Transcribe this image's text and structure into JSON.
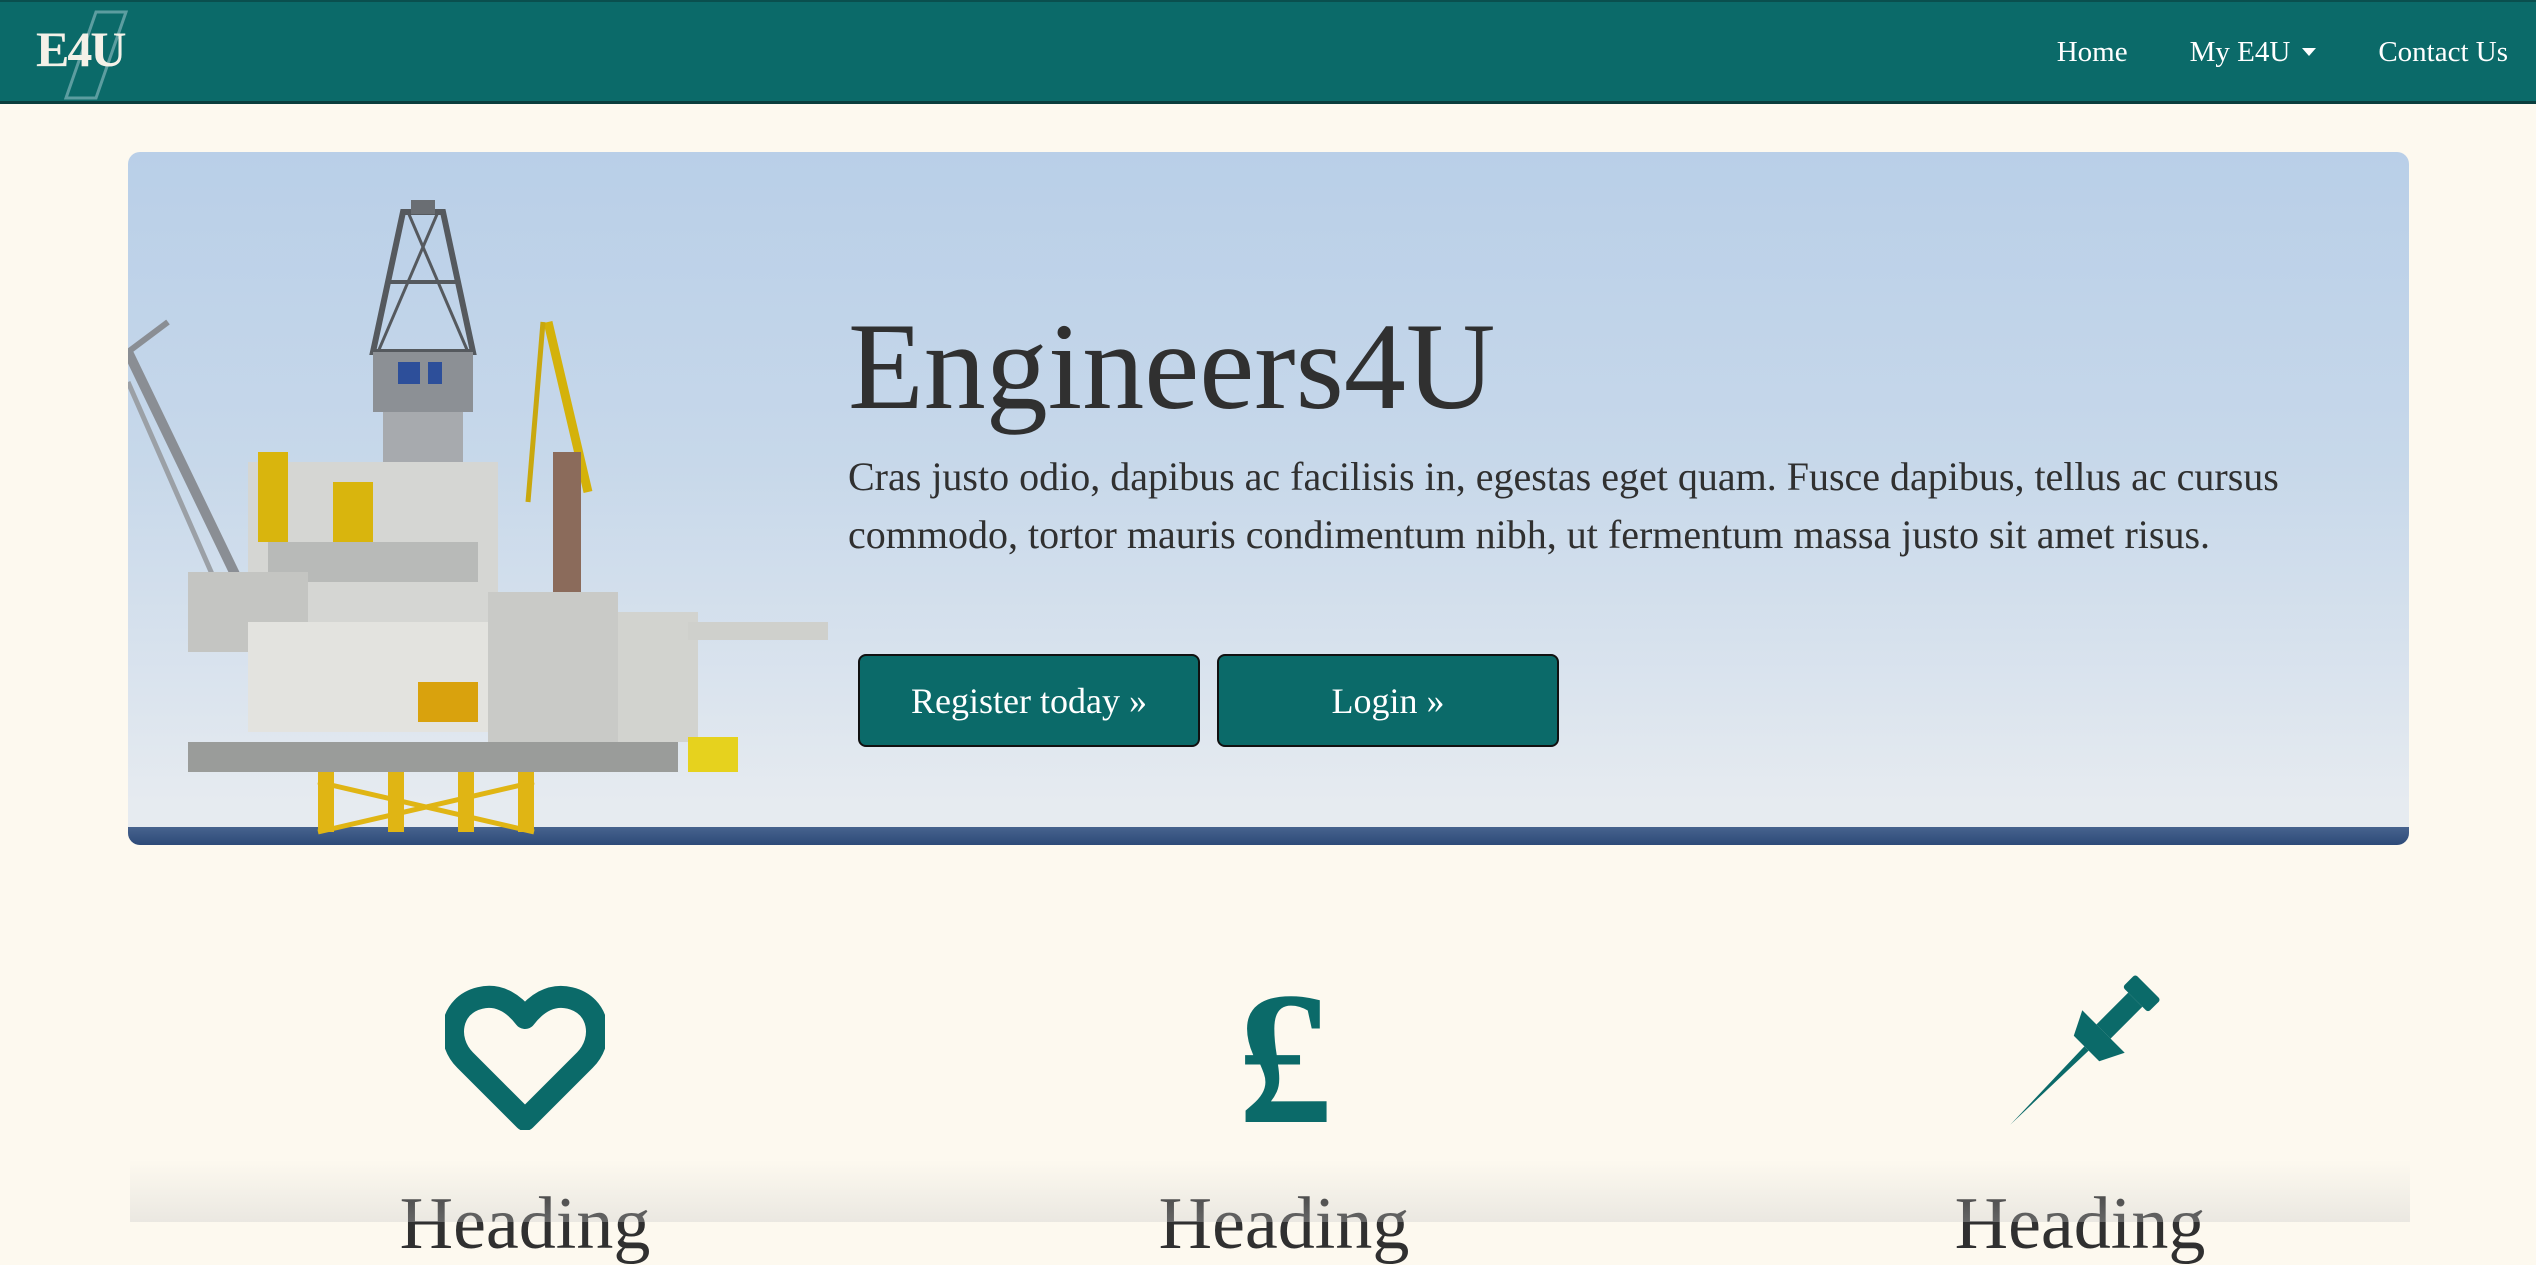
{
  "navbar": {
    "brand": "E4U",
    "links": [
      {
        "label": "Home"
      },
      {
        "label": "My E4U"
      },
      {
        "label": "Contact Us"
      }
    ]
  },
  "hero": {
    "title": "Engineers4U",
    "text": "Cras justo odio, dapibus ac facilisis in, egestas eget quam. Fusce dapibus, tellus ac cursus commodo, tortor mauris condimentum nibh, ut fermentum massa justo sit amet risus.",
    "register_label": "Register today »",
    "login_label": "Login »"
  },
  "features": [
    {
      "icon": "heart-icon",
      "heading": "Heading"
    },
    {
      "icon": "pound-icon",
      "heading": "Heading"
    },
    {
      "icon": "pushpin-icon",
      "heading": "Heading"
    }
  ],
  "colors": {
    "brand": "#0b6a69",
    "background": "#fdf9ef",
    "text": "#303030"
  }
}
